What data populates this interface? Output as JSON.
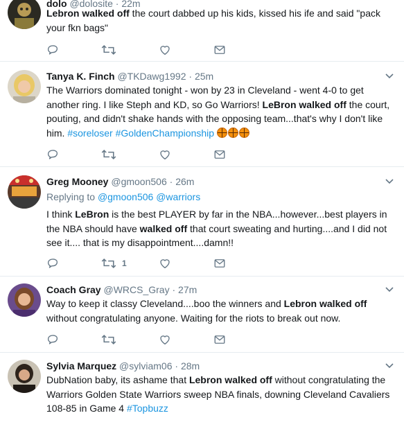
{
  "tweets": [
    {
      "name": "dolo",
      "handle": "@dolosite",
      "time": "22m",
      "segments": [
        {
          "t": "Lebron walked off",
          "b": true
        },
        {
          "t": " the court dabbed up his kids, kissed his ife and said \"pack your fkn bags\""
        }
      ],
      "actions": {
        "reply_count": "",
        "retweet_count": "",
        "like_count": ""
      }
    },
    {
      "name": "Tanya K. Finch",
      "handle": "@TKDawg1992",
      "time": "25m",
      "segments": [
        {
          "t": "The Warriors dominated tonight - won by 23 in Cleveland - went 4-0 to get another ring. I like Steph and KD, so Go Warriors! "
        },
        {
          "t": "LeBron walked off",
          "b": true
        },
        {
          "t": " the court, pouting, and didn't shake hands with the opposing team...that's why I don't like him. "
        },
        {
          "t": "#soreloser",
          "link": true
        },
        {
          "t": " "
        },
        {
          "t": "#GoldenChampionship",
          "link": true
        },
        {
          "t": " "
        }
      ],
      "emojis": [
        "basketball",
        "basketball",
        "basketball"
      ],
      "actions": {
        "reply_count": "",
        "retweet_count": "",
        "like_count": ""
      }
    },
    {
      "name": "Greg Mooney",
      "handle": "@gmoon506",
      "time": "26m",
      "replying_prefix": "Replying to ",
      "replying_to": [
        "@gmoon506",
        "@warriors"
      ],
      "segments": [
        {
          "t": "I think "
        },
        {
          "t": "LeBron",
          "b": true
        },
        {
          "t": " is the best PLAYER by far in the NBA...however...best players in the NBA should have "
        },
        {
          "t": "walked off",
          "b": true
        },
        {
          "t": " that court sweating and hurting....and I did not see it.... that is my disappointment....damn!!"
        }
      ],
      "actions": {
        "reply_count": "",
        "retweet_count": "1",
        "like_count": ""
      }
    },
    {
      "name": "Coach Gray",
      "handle": "@WRCS_Gray",
      "time": "27m",
      "segments": [
        {
          "t": "Way to keep it classy Cleveland....boo the winners and "
        },
        {
          "t": "Lebron walked off",
          "b": true
        },
        {
          "t": " without congratulating anyone. Waiting for the riots to break out now."
        }
      ],
      "actions": {
        "reply_count": "",
        "retweet_count": "",
        "like_count": ""
      }
    },
    {
      "name": "Sylvia Marquez",
      "handle": "@sylviam06",
      "time": "28m",
      "segments": [
        {
          "t": "DubNation baby, its ashame that "
        },
        {
          "t": "Lebron walked off",
          "b": true
        },
        {
          "t": " without congratulating the Warriors Golden State Warriors sweep NBA finals, downing Cleveland Cavaliers 108-85 in Game 4 "
        },
        {
          "t": "#Topbuzz",
          "link": true
        }
      ],
      "actions": {
        "reply_count": "",
        "retweet_count": "",
        "like_count": ""
      }
    }
  ],
  "separator": "·",
  "icons": {
    "reply": "reply-icon",
    "retweet": "retweet-icon",
    "like": "heart-icon",
    "dm": "envelope-icon",
    "caret": "chevron-down-icon"
  },
  "colors": {
    "link": "#1b95e0",
    "muted": "#657786",
    "text": "#14171a",
    "border": "#e6ecf0"
  }
}
